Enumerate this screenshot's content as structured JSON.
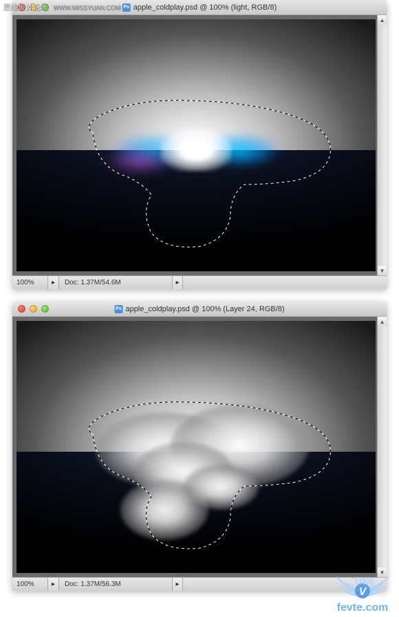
{
  "watermark_top": {
    "text": "思缘设计论坛",
    "url": "WWW.MISSYUAN.COM"
  },
  "window1": {
    "title": "apple_coldplay.psd @ 100% (light, RGB/8)",
    "zoom": "100%",
    "doc_info": "Doc: 1.37M/54.6M"
  },
  "window2": {
    "title": "apple_coldplay.psd @ 100% (Layer 24, RGB/8)",
    "zoom": "100%",
    "doc_info": "Doc: 1.37M/56.3M"
  },
  "watermark_bottom": {
    "brand_cn": "飞特网",
    "brand_url": "fevte.com"
  }
}
